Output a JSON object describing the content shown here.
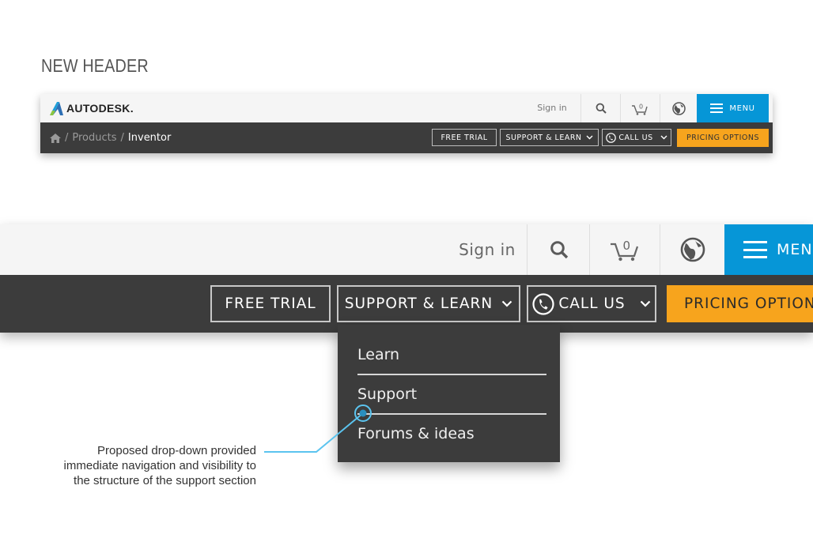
{
  "heading": "NEW HEADER",
  "brand": {
    "logo_text": "AUTODESK.",
    "accent": "#0696d7",
    "pricing_color": "#f7a41d",
    "bar_color": "#3c3c3c"
  },
  "header": {
    "sign_in": "Sign in",
    "cart_count": "0",
    "menu_label": "MENU",
    "icons": [
      "search-icon",
      "cart-icon",
      "globe-icon",
      "hamburger-icon"
    ]
  },
  "breadcrumb": {
    "home_icon": "home-icon",
    "items": [
      "Products",
      "Inventor"
    ]
  },
  "actions": {
    "free_trial": "FREE TRIAL",
    "support_learn": "SUPPORT & LEARN",
    "call_us": "CALL US",
    "pricing": "PRICING OPTIONS",
    "pricing_large": "PRICING OPTION"
  },
  "dropdown": {
    "items": [
      "Learn",
      "Support",
      "Forums & ideas"
    ]
  },
  "annotation": {
    "lines": [
      "Proposed drop-down provided",
      "immediate navigation and visibility to",
      "the structure of the support section"
    ],
    "color": "#5bc4ef"
  }
}
